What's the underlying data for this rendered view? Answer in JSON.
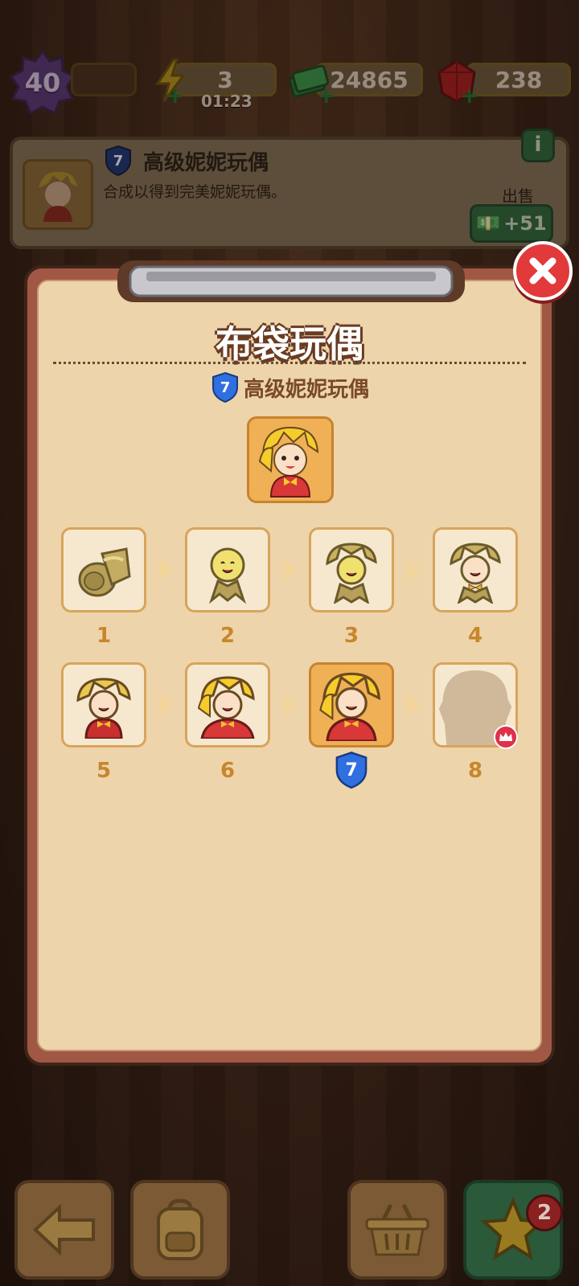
{
  "resources": {
    "level": "40",
    "energy": "3",
    "energy_timer": "01:23",
    "cash": "24865",
    "gems": "238"
  },
  "info_card": {
    "level_badge": "7",
    "title": "高级妮妮玩偶",
    "description": "合成以得到完美妮妮玩偶。",
    "sell_label": "出售",
    "sell_value": "+51"
  },
  "modal": {
    "title": "布袋玩偶",
    "subtitle_level": "7",
    "subtitle": "高级妮妮玩偶",
    "current_level_badge": "7",
    "chain": [
      {
        "level": "1",
        "icon": "burlap-roll-icon"
      },
      {
        "level": "2",
        "icon": "smiley-burlap-doll-icon"
      },
      {
        "level": "3",
        "icon": "hatted-burlap-doll-icon"
      },
      {
        "level": "4",
        "icon": "bowtie-burlap-doll-icon"
      },
      {
        "level": "5",
        "icon": "red-dress-doll-icon"
      },
      {
        "level": "6",
        "icon": "blonde-doll-icon"
      },
      {
        "level": "7",
        "icon": "advanced-nini-doll-icon"
      },
      {
        "level": "8",
        "icon": "locked-silhouette-icon"
      }
    ]
  },
  "bottom_bar": {
    "star_badge_count": "2"
  },
  "colors": {
    "modal_frame": "#a05844",
    "modal_paper": "#edd4aa",
    "tile_border": "#d8a45c",
    "highlight_tile": "#f0b056",
    "level_number": "#c8862c",
    "close_red": "#e23a3a",
    "shield_blue": "#2f6fe0"
  }
}
